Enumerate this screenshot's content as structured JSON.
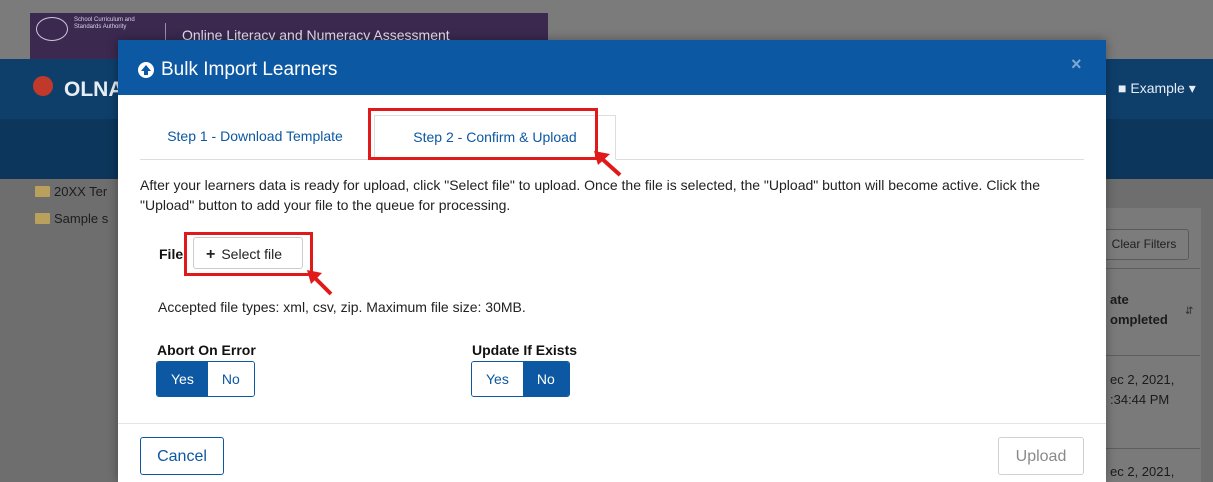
{
  "background": {
    "logo_text": "School Curriculum and Standards Authority",
    "header_title": "Online Literacy and Numeracy Assessment",
    "brand": "OLNA",
    "user_menu": "Example",
    "tree_items": [
      "20XX Ter",
      "Sample s"
    ],
    "clear_filters": "Clear Filters",
    "column_header": "ate\nompleted",
    "cells": [
      "ec 2, 2021,\n:34:44 PM",
      "ec 2, 2021,"
    ]
  },
  "modal": {
    "title": "Bulk Import Learners",
    "close_symbol": "×",
    "tabs": [
      {
        "label": "Step 1 - Download Template"
      },
      {
        "label": "Step 2 - Confirm & Upload"
      }
    ],
    "description": "After your learners data is ready for upload, click \"Select file\" to upload. Once the file is selected, the \"Upload\" button will become active. Click the \"Upload\" button to add your file to the queue for processing.",
    "file_label": "File",
    "select_file_label": "Select file",
    "accepted_types": "Accepted file types: xml, csv, zip. Maximum file size: 30MB.",
    "abort_on_error": {
      "label": "Abort On Error",
      "yes": "Yes",
      "no": "No",
      "selected": "Yes"
    },
    "update_if_exists": {
      "label": "Update If Exists",
      "yes": "Yes",
      "no": "No",
      "selected": "No"
    },
    "cancel_label": "Cancel",
    "upload_label": "Upload"
  },
  "colors": {
    "primary": "#0c58a3",
    "highlight": "#e01a1a"
  }
}
